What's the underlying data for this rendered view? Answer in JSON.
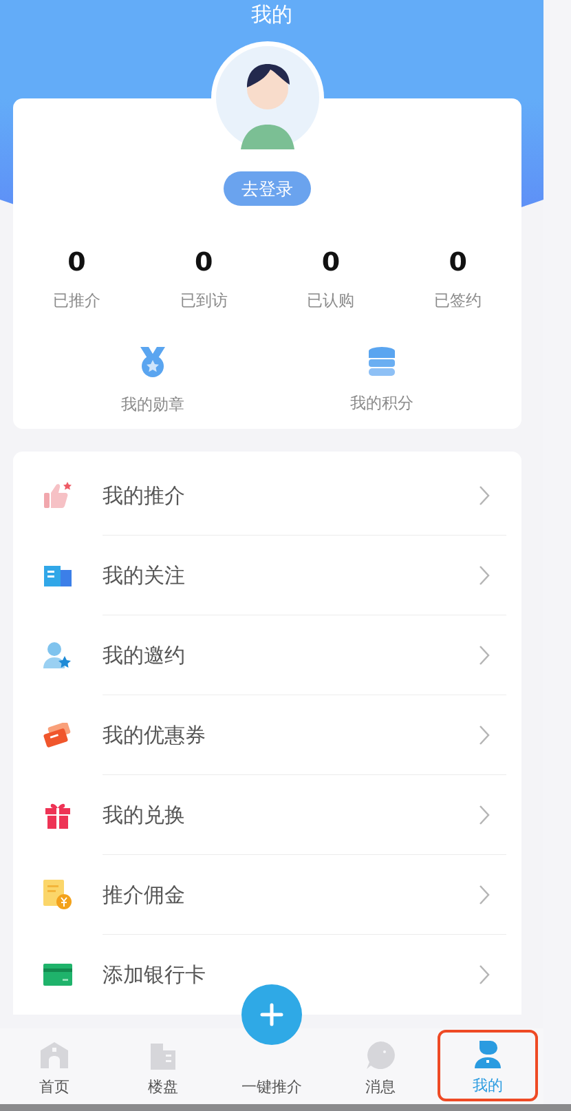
{
  "header": {
    "title": "我的"
  },
  "profile": {
    "login_button": "去登录",
    "stats": [
      {
        "value": "0",
        "label": "已推介"
      },
      {
        "value": "0",
        "label": "已到访"
      },
      {
        "value": "0",
        "label": "已认购"
      },
      {
        "value": "0",
        "label": "已签约"
      }
    ],
    "shortcuts": [
      {
        "kind": "medal",
        "label": "我的勋章"
      },
      {
        "kind": "coins",
        "label": "我的积分"
      }
    ]
  },
  "menu": [
    {
      "kind": "thumb",
      "label": "我的推介"
    },
    {
      "kind": "building",
      "label": "我的关注"
    },
    {
      "kind": "invite",
      "label": "我的邀约"
    },
    {
      "kind": "coupon",
      "label": "我的优惠券"
    },
    {
      "kind": "gift",
      "label": "我的兑换"
    },
    {
      "kind": "bill",
      "label": "推介佣金"
    },
    {
      "kind": "card",
      "label": "添加银行卡"
    }
  ],
  "tab_bar": [
    {
      "kind": "home",
      "label": "首页",
      "selected": false,
      "highlighted": false
    },
    {
      "kind": "buildings",
      "label": "楼盘",
      "selected": false,
      "highlighted": false
    },
    {
      "kind": "plus",
      "label": "一键推介",
      "selected": false,
      "highlighted": false
    },
    {
      "kind": "chat",
      "label": "消息",
      "selected": false,
      "highlighted": false
    },
    {
      "kind": "person",
      "label": "我的",
      "selected": true,
      "highlighted": true
    }
  ]
}
